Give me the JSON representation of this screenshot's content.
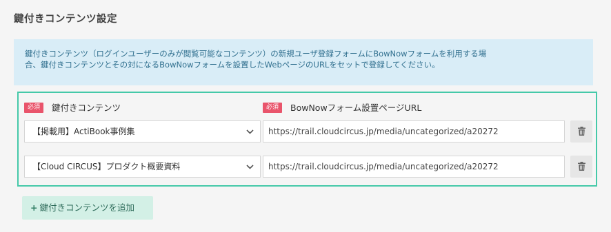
{
  "section": {
    "title": "鍵付きコンテンツ設定"
  },
  "info": {
    "line1": "鍵付きコンテンツ（ログインユーザーのみが閲覧可能なコンテンツ）の新規ユーザ登録フォームにBowNowフォームを利用する場",
    "line2": "合、鍵付きコンテンツとその対になるBowNowフォームを設置したWebページのURLをセットで登録してください。"
  },
  "table": {
    "required_badge": "必須",
    "col_content_label": "鍵付きコンテンツ",
    "col_url_label": "BowNowフォーム設置ページURL",
    "rows": [
      {
        "content": "【掲載用】ActiBook事例集",
        "url": "https://trail.cloudcircus.jp/media/uncategorized/a20272"
      },
      {
        "content": "【Cloud CIRCUS】プロダクト概要資料",
        "url": "https://trail.cloudcircus.jp/media/uncategorized/a20272"
      }
    ]
  },
  "actions": {
    "add_plus": "+",
    "add_label": "鍵付きコンテンツを追加"
  },
  "icons": {
    "chevron": "chevron-down-icon",
    "trash": "trash-icon",
    "plus": "plus-icon"
  },
  "colors": {
    "accent_border": "#45c9a9",
    "required_badge": "#e9546b",
    "info_bg": "#d9edf7",
    "info_text": "#31708f",
    "add_button_bg": "#d3f0e6"
  }
}
